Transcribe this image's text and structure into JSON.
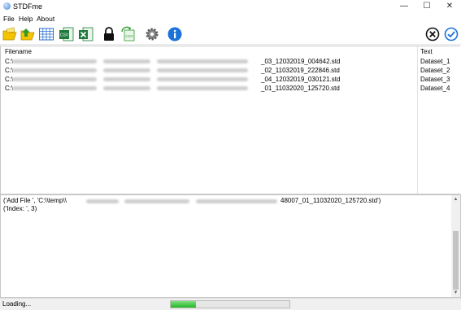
{
  "window": {
    "title": "STDFme",
    "minimize_glyph": "—",
    "maximize_glyph": "☐",
    "close_glyph": "✕"
  },
  "menu": [
    "File",
    "Help",
    "About"
  ],
  "toolbar": {
    "icons": [
      "open-folder-icon",
      "open-file-icon",
      "table-icon",
      "csv-export-icon",
      "excel-export-icon",
      "lock-icon",
      "refresh-csv-icon",
      "settings-icon",
      "info-icon",
      "cancel-icon",
      "ok-icon"
    ]
  },
  "file_list": {
    "columns": [
      "Filename",
      "Text"
    ],
    "rows": [
      {
        "prefix": "C:\\",
        "suffix": "_03_12032019_004642.std",
        "text": "Dataset_1"
      },
      {
        "prefix": "C:\\",
        "suffix": "_02_11032019_222846.std",
        "text": "Dataset_2"
      },
      {
        "prefix": "C:\\",
        "suffix": "_04_12032019_030121.std",
        "text": "Dataset_3"
      },
      {
        "prefix": "C:\\",
        "suffix": "_01_11032020_125720.std",
        "text": "Dataset_4"
      }
    ]
  },
  "log": {
    "line1_start": "('Add File ', 'C:\\\\temp\\\\",
    "line1_end": "48007_01_11032020_125720.std')",
    "line2": "('Index: ', 3)"
  },
  "status": {
    "text": "Loading...",
    "progress": 0.21
  },
  "colors": {
    "progress_green": "#26b526",
    "info_blue": "#1a73d9",
    "ok_blue": "#1a73d9"
  }
}
